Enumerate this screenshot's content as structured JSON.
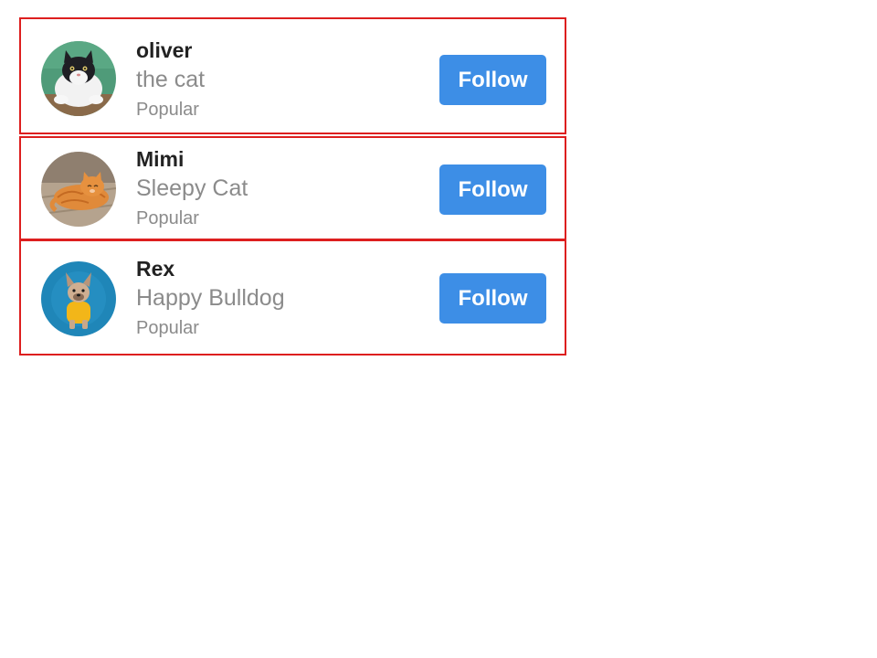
{
  "cards": [
    {
      "name": "oliver",
      "subtitle": "the cat",
      "tag": "Popular",
      "follow_label": "Follow",
      "avatar": "cat-photo-black-white"
    },
    {
      "name": "Mimi",
      "subtitle": "Sleepy Cat",
      "tag": "Popular",
      "follow_label": "Follow",
      "avatar": "cat-photo-orange-tabby"
    },
    {
      "name": "Rex",
      "subtitle": "Happy Bulldog",
      "tag": "Popular",
      "follow_label": "Follow",
      "avatar": "dog-photo-french-bulldog"
    }
  ],
  "colors": {
    "card_border": "#dd1f1f",
    "follow_button": "#3d8ee6",
    "name_text": "#222222",
    "muted_text": "#8b8b8b"
  }
}
